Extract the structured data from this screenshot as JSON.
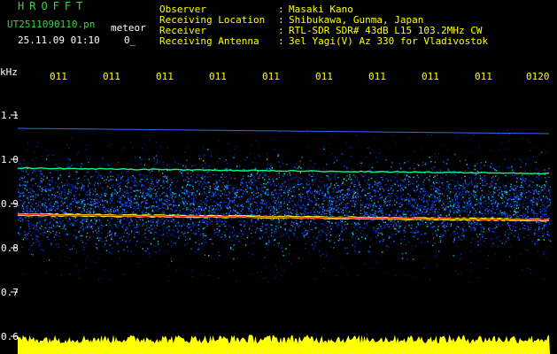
{
  "header": {
    "brand": "HROFFT",
    "filename": "UT2511090110.pn",
    "tag": "meteor",
    "datetime": "25.11.09 01:10",
    "zero_mark": "0_",
    "info": [
      {
        "key": "Observer",
        "sep": ":",
        "value": "Masaki Kano"
      },
      {
        "key": "Receiving Location",
        "sep": ":",
        "value": "Shibukawa, Gunma, Japan"
      },
      {
        "key": "Receiver",
        "sep": ":",
        "value": "RTL-SDR SDR# 43dB L15 103.2MHz CW"
      },
      {
        "key": "Receiving Antenna",
        "sep": ":",
        "value": "3el Yagi(V) Az 330 for Vladivostok"
      }
    ]
  },
  "spectrogram": {
    "y_unit": "kHz",
    "y_ticks": [
      "1.1",
      "1.0",
      "0.9",
      "0.8",
      "0.7",
      "0.6"
    ],
    "y_tick_values": [
      1.1,
      1.0,
      0.9,
      0.8,
      0.7,
      0.6
    ],
    "time_labels": [
      "011",
      "011",
      "011",
      "011",
      "011",
      "011",
      "011",
      "011",
      "011",
      "0120"
    ],
    "background_color": "#000000",
    "noise_color": "#ffff00",
    "signal_colors": [
      "#0033cc",
      "#3366ff",
      "#00c0ff",
      "#00ffc0",
      "#ffff00",
      "#ff2020"
    ],
    "carrier_line_khz": 0.875,
    "secondary_line_khz": 0.98,
    "upper_line_khz": 1.07
  }
}
